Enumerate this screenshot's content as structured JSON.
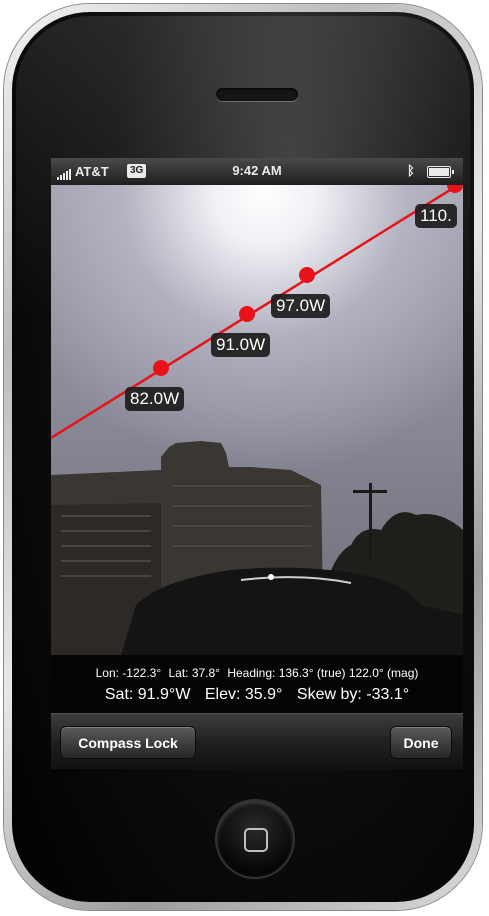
{
  "status_bar": {
    "carrier": "AT&T",
    "network": "3G",
    "time": "9:42 AM"
  },
  "track_points": [
    {
      "label": "82.0W"
    },
    {
      "label": "91.0W"
    },
    {
      "label": "97.0W"
    },
    {
      "label": "110."
    }
  ],
  "info": {
    "lon": "Lon: -122.3°",
    "lat": "Lat: 37.8°",
    "heading": "Heading: 136.3° (true) 122.0° (mag)",
    "sat": "Sat: 91.9°W",
    "elev": "Elev: 35.9°",
    "skew": "Skew by: -33.1°"
  },
  "toolbar": {
    "compass_lock_label": "Compass Lock",
    "done_label": "Done"
  },
  "colors": {
    "track_line": "#e8121a",
    "label_bg": "#1c1c1c"
  }
}
